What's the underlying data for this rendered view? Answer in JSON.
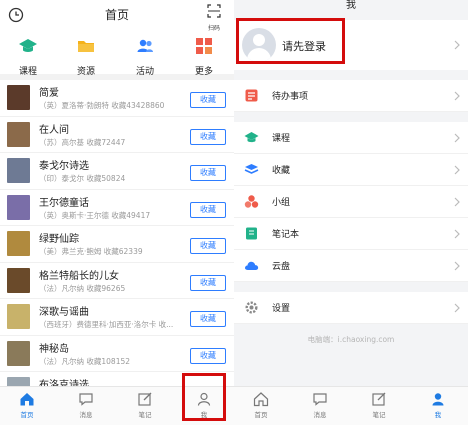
{
  "home": {
    "title": "首页",
    "scan_label": "扫码",
    "quick": [
      {
        "label": "课程",
        "icon": "graduation-cap-icon"
      },
      {
        "label": "资源",
        "icon": "folder-icon"
      },
      {
        "label": "活动",
        "icon": "people-icon"
      },
      {
        "label": "更多",
        "icon": "grid-icon"
      }
    ],
    "fav_label": "收藏",
    "books": [
      {
        "title": "简爱",
        "meta": "（英）夏洛蒂·勃朗特 收藏43428860",
        "color": "#5b3a2a"
      },
      {
        "title": "在人间",
        "meta": "（苏）高尔基 收藏72447",
        "color": "#8b6a4a"
      },
      {
        "title": "泰戈尔诗选",
        "meta": "（印）泰戈尔 收藏50824",
        "color": "#6e7a94"
      },
      {
        "title": "王尔德童话",
        "meta": "（英）奥斯卡·王尔德 收藏49417",
        "color": "#7a6ea8"
      },
      {
        "title": "绿野仙踪",
        "meta": "（美）弗兰克·鲍姆 收藏62339",
        "color": "#b08a3e"
      },
      {
        "title": "格兰特船长的儿女",
        "meta": "（法）凡尔纳 收藏96265",
        "color": "#6a4a2a"
      },
      {
        "title": "深歌与谣曲",
        "meta": "（西班牙）费德里科·加西亚·洛尔卡 收...",
        "color": "#c8b26a"
      },
      {
        "title": "神秘岛",
        "meta": "（法）凡尔纳 收藏108152",
        "color": "#8a7a5a"
      },
      {
        "title": "布洛克诗选",
        "meta": "",
        "color": "#9aa6b0"
      }
    ],
    "tabs": [
      {
        "label": "首页",
        "icon": "home-icon"
      },
      {
        "label": "消息",
        "icon": "message-icon"
      },
      {
        "label": "笔记",
        "icon": "note-icon"
      },
      {
        "label": "我",
        "icon": "user-icon"
      }
    ]
  },
  "me": {
    "title": "我",
    "login_text": "请先登录",
    "items_group1": [
      {
        "label": "待办事项",
        "icon": "todo-icon",
        "color": "#ef5b4a"
      }
    ],
    "items_group2": [
      {
        "label": "课程",
        "icon": "graduation-cap-icon",
        "color": "#21b28a"
      },
      {
        "label": "收藏",
        "icon": "bookmark-icon",
        "color": "#2e7dff"
      },
      {
        "label": "小组",
        "icon": "group-icon",
        "color": "#ef5b4a"
      },
      {
        "label": "笔记本",
        "icon": "notebook-icon",
        "color": "#21b28a"
      },
      {
        "label": "云盘",
        "icon": "cloud-icon",
        "color": "#2e7dff"
      }
    ],
    "items_group3": [
      {
        "label": "设置",
        "icon": "gear-icon",
        "color": "#888888"
      }
    ],
    "footer": "电脑端：i.chaoxing.com",
    "tabs": [
      {
        "label": "首页",
        "icon": "home-icon"
      },
      {
        "label": "消息",
        "icon": "message-icon"
      },
      {
        "label": "笔记",
        "icon": "note-icon"
      },
      {
        "label": "我",
        "icon": "user-icon"
      }
    ]
  }
}
